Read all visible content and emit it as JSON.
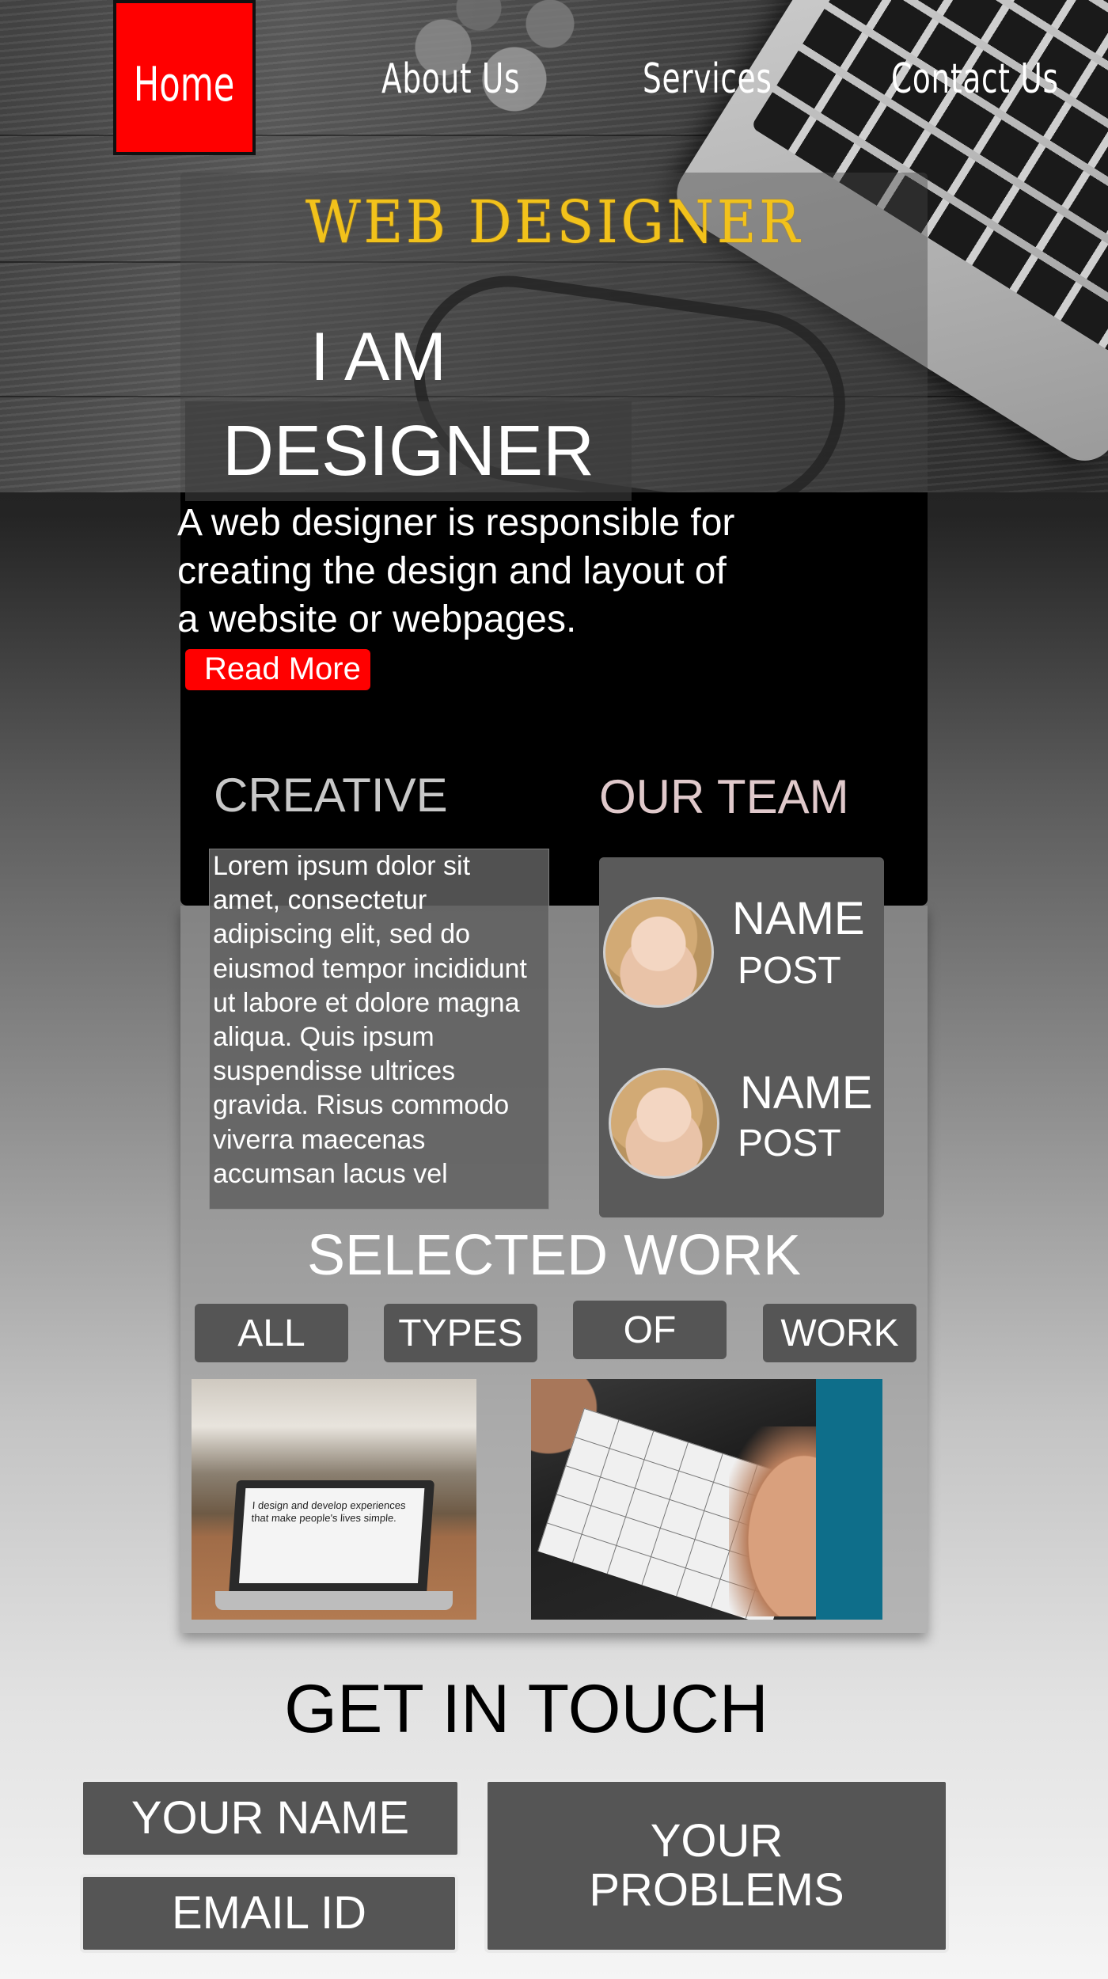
{
  "nav": {
    "items": [
      {
        "label": "Home"
      },
      {
        "label": "About Us"
      },
      {
        "label": "Services"
      },
      {
        "label": "Contact Us"
      }
    ],
    "active_color": "#ff0000"
  },
  "hero": {
    "brand_title": "WEB DESIGNER",
    "line1": "I AM",
    "line2": "DESIGNER",
    "intro": "A web designer is responsible for creating the design and layout of a website or webpages.",
    "read_more": "Read More"
  },
  "creative": {
    "heading": "CREATIVE",
    "lines": [
      "Lorem ipsum dolor sit",
      "amet, consectetur",
      "adipiscing elit, sed do",
      "eiusmod tempor incididunt",
      "ut labore et dolore magna",
      "aliqua. Quis ipsum",
      "suspendisse ultrices",
      "gravida. Risus commodo",
      "viverra maecenas",
      "accumsan lacus vel"
    ]
  },
  "team": {
    "heading": "OUR TEAM",
    "members": [
      {
        "name": "NAME",
        "post": "POST"
      },
      {
        "name": "NAME",
        "post": "POST"
      }
    ]
  },
  "work": {
    "heading": "SELECTED WORK",
    "filters": [
      "ALL",
      "TYPES",
      "OF",
      "WORK"
    ],
    "laptop_screen_text": "I design and develop experiences that make people's lives simple."
  },
  "contact": {
    "heading": "GET IN TOUCH",
    "name_field": "YOUR NAME",
    "email_field": "EMAIL ID",
    "problems_line1": "YOUR",
    "problems_line2": "PROBLEMS"
  },
  "colors": {
    "accent": "#ff0000",
    "gold": "#f2c21b",
    "button_gray": "#555555"
  }
}
